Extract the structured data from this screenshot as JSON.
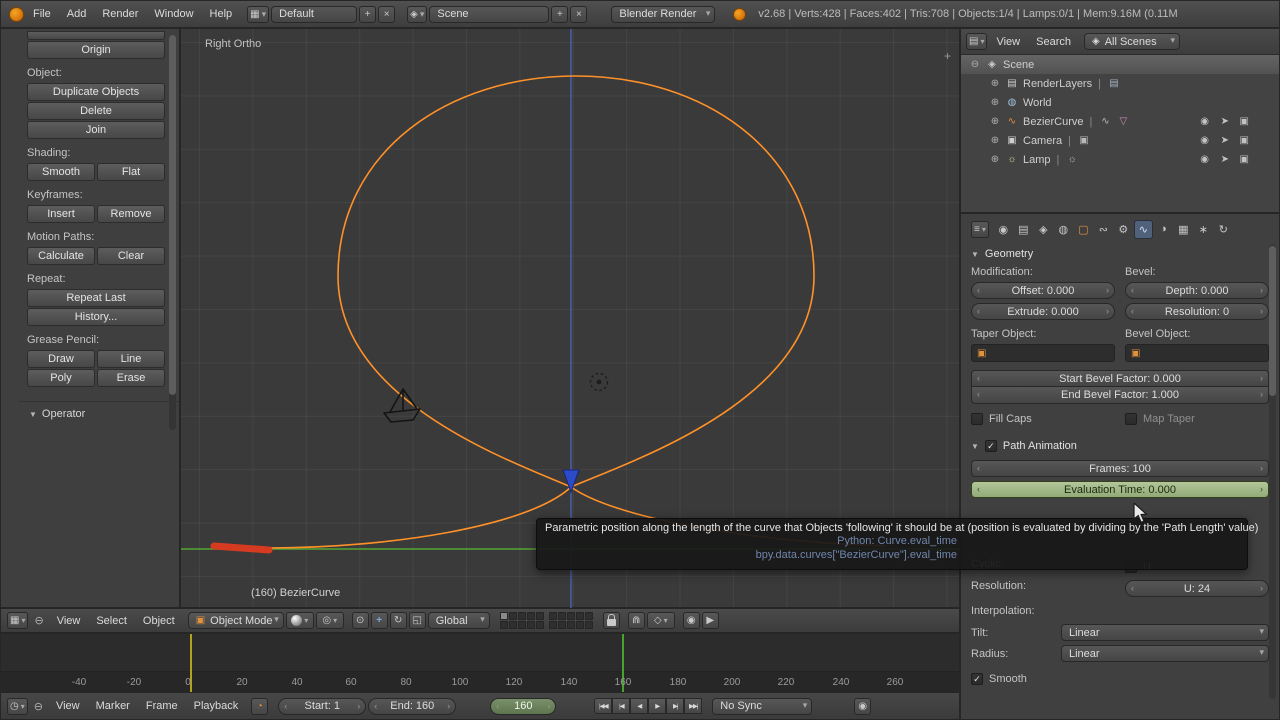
{
  "colors": {
    "curve_orange": "#ff9128",
    "axis_z_blue": "#4a62b8",
    "axis_y_green": "#55a532",
    "handle_red": "#d63b22",
    "current_frame_green": "#46a42e",
    "keyframe_yellow": "#b3a31c",
    "animated_field_green": "#a0b985",
    "active_tab_blue": "#50617c"
  },
  "icons": {
    "dd": "▾",
    "check": "✓",
    "plus": "+",
    "x": "×",
    "tri": "▼",
    "plus_c": "⊕",
    "minus_c": "⊖",
    "pin": "⊖",
    "editor_3d": "▦",
    "editor_timeline": "◷",
    "editor_outliner": "▤",
    "editor_props": "≡",
    "cube": "▣",
    "pivot": "◎",
    "manip_cursor": "⊙",
    "manip_translate": "+",
    "manip_rotate": "↻",
    "manip_scale": "◱",
    "magnet": "⋒",
    "snap": "◇",
    "render_still": "◉",
    "render_anim": "▶",
    "clock": "◔",
    "jump_start": "|◀◀",
    "prev_key": "|◀",
    "play_rev": "◀",
    "play": "▶",
    "next_key": "▶|",
    "jump_end": "▶▶|",
    "record": "◉",
    "scene": "◈",
    "renderlayers": "▤",
    "renderlayer": "▤",
    "world": "◍",
    "curve": "∿",
    "camera": "▣",
    "lamp": "☼",
    "eye": "◉",
    "select_arrow": "➤",
    "render_toggle": "▣",
    "tri_down": "▽",
    "npanel_plus": "+",
    "tab_render": "◉",
    "tab_layers": "▤",
    "tab_scene": "◈",
    "tab_world": "◍",
    "tab_object": "▢",
    "tab_constraints": "∾",
    "tab_modifiers": "⚙",
    "tab_data": "∿",
    "tab_material": "◑",
    "tab_texture": "▦",
    "tab_particles": "∗",
    "tab_physics": "↻"
  },
  "topbar": {
    "menus": [
      {
        "label": "File"
      },
      {
        "label": "Add"
      },
      {
        "label": "Render"
      },
      {
        "label": "Window"
      },
      {
        "label": "Help"
      }
    ],
    "layout": "Default",
    "scene": "Scene",
    "engine": "Blender Render",
    "stats": "v2.68 | Verts:428 | Faces:402 | Tris:708 | Objects:1/4 | Lamps:0/1 | Mem:9.16M (0.11M"
  },
  "toolshelf": {
    "origin": "Origin",
    "object_label": "Object:",
    "duplicate": "Duplicate Objects",
    "delete": "Delete",
    "join": "Join",
    "shading_label": "Shading:",
    "smooth": "Smooth",
    "flat": "Flat",
    "keyframes_label": "Keyframes:",
    "insert": "Insert",
    "remove": "Remove",
    "motion_label": "Motion Paths:",
    "calculate": "Calculate",
    "clear": "Clear",
    "repeat_label": "Repeat:",
    "repeat_last": "Repeat Last",
    "history": "History...",
    "grease_label": "Grease Pencil:",
    "draw": "Draw",
    "line": "Line",
    "poly": "Poly",
    "erase": "Erase",
    "operator": "Operator"
  },
  "viewport": {
    "view_label": "Right Ortho",
    "object_label": "(160) BezierCurve"
  },
  "v3d_header": {
    "menus": [
      {
        "label": "View"
      },
      {
        "label": "Select"
      },
      {
        "label": "Object"
      }
    ],
    "mode": "Object Mode",
    "orientation": "Global"
  },
  "timeline": {
    "ticks": [
      "-40",
      "-20",
      "0",
      "20",
      "40",
      "60",
      "80",
      "100",
      "120",
      "140",
      "160",
      "180",
      "200",
      "220",
      "240",
      "260"
    ],
    "menus": [
      {
        "label": "View"
      },
      {
        "label": "Marker"
      },
      {
        "label": "Frame"
      },
      {
        "label": "Playback"
      }
    ],
    "start": "Start: 1",
    "end": "End: 160",
    "current": "160",
    "sync": "No Sync"
  },
  "outliner": {
    "view": "View",
    "search": "Search",
    "scenes_filter": "All Scenes",
    "rows": [
      {
        "name": "Scene"
      },
      {
        "name": "RenderLayers"
      },
      {
        "name": "World"
      },
      {
        "name": "BezierCurve"
      },
      {
        "name": "Camera"
      },
      {
        "name": "Lamp"
      }
    ]
  },
  "properties": {
    "geometry": {
      "title": "Geometry",
      "modification_label": "Modification:",
      "bevel_label": "Bevel:",
      "offset": "Offset: 0.000",
      "extrude": "Extrude: 0.000",
      "depth": "Depth: 0.000",
      "resolution": "Resolution: 0",
      "taper_label": "Taper Object:",
      "bevel_object_label": "Bevel Object:",
      "start_bevel": "Start Bevel Factor: 0.000",
      "end_bevel": "End Bevel Factor: 1.000",
      "fill_caps": "Fill Caps",
      "map_taper": "Map Taper"
    },
    "path_animation": {
      "title": "Path Animation",
      "frames": "Frames: 100",
      "eval_time": "Evaluation Time: 0.000"
    },
    "curve_extra": {
      "cyclic_label": "Cyclic:",
      "cyclic_u": "U",
      "resolution_label": "Resolution:",
      "resolution_u": "U: 24",
      "interpolation_label": "Interpolation:",
      "tilt_label": "Tilt:",
      "tilt_value": "Linear",
      "radius_label": "Radius:",
      "radius_value": "Linear",
      "smooth": "Smooth"
    }
  },
  "tooltip": {
    "text": "Parametric position along the length of the curve that Objects 'following' it should be at (position is evaluated by dividing by the 'Path Length' value)",
    "python_label": "Python: Curve.eval_time",
    "python_path": "bpy.data.curves[\"BezierCurve\"].eval_time"
  }
}
